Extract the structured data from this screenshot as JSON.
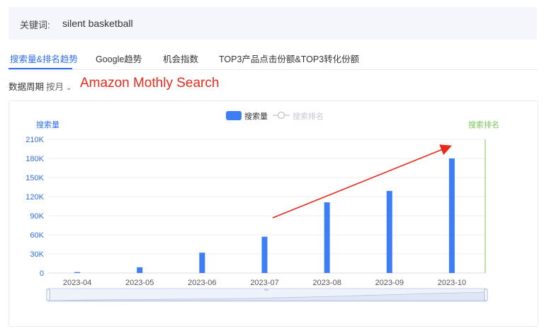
{
  "keyword": {
    "label": "关键词:",
    "value": "silent basketball"
  },
  "tabs": [
    {
      "label": "搜索量&排名趋势",
      "active": true
    },
    {
      "label": "Google趋势",
      "active": false
    },
    {
      "label": "机会指数",
      "active": false
    },
    {
      "label": "TOP3产品点击份额&TOP3转化份额",
      "active": false
    }
  ],
  "period": {
    "label": "数据周期",
    "selected": "按月"
  },
  "annotation": {
    "text": "Amazon Mothly Search",
    "color": "#e8291c"
  },
  "colors": {
    "accent": "#2f6fe8",
    "bar": "#3d7ef7",
    "rank_axis": "#7cc45a",
    "arrow": "#e8291c"
  },
  "chart_data": {
    "type": "bar",
    "categories": [
      "2023-04",
      "2023-05",
      "2023-06",
      "2023-07",
      "2023-08",
      "2023-09",
      "2023-10"
    ],
    "series": [
      {
        "name": "搜索量",
        "values": [
          1500,
          9000,
          32000,
          57000,
          111000,
          129000,
          180000
        ]
      }
    ],
    "legend": [
      "搜索量",
      "搜索排名"
    ],
    "ylabel": "搜索量",
    "y2label": "搜索排名",
    "ylim": [
      0,
      210000
    ],
    "yticks": [
      "0",
      "30K",
      "60K",
      "90K",
      "120K",
      "150K",
      "180K",
      "210K"
    ],
    "grid": true,
    "legend_position": "top-center"
  }
}
